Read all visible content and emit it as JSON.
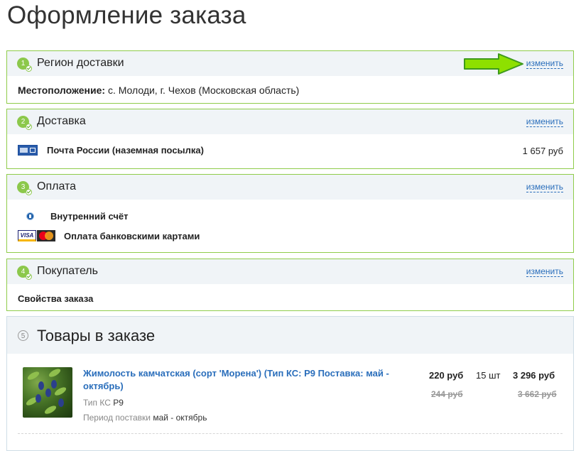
{
  "page": {
    "title": "Оформление заказа"
  },
  "colors": {
    "section_border": "#8fcc4a",
    "header_bg": "#f0f4f7",
    "link": "#2a6ebb",
    "step": "#8cc84b",
    "arrow": "#8ee000"
  },
  "sections": {
    "region": {
      "step": "1",
      "title": "Регион доставки",
      "change_label": "изменить",
      "location_label": "Местоположение:",
      "location_value": "с. Молоди, г. Чехов (Московская область)"
    },
    "delivery": {
      "step": "2",
      "title": "Доставка",
      "change_label": "изменить",
      "method": "Почта России (наземная посылка)",
      "price": "1 657 руб"
    },
    "payment": {
      "step": "3",
      "title": "Оплата",
      "change_label": "изменить",
      "internal_account": "Внутренний счёт",
      "bank_cards": "Оплата банковскими картами",
      "visa_label": "VISA"
    },
    "buyer": {
      "step": "4",
      "title": "Покупатель",
      "change_label": "изменить",
      "order_props": "Свойства заказа"
    }
  },
  "goods": {
    "step": "5",
    "title": "Товары в заказе",
    "items": [
      {
        "name": "Жимолость камчатская (сорт 'Морена') (Тип КС: Р9 Поставка: май - октябрь)",
        "prop1_label": "Тип КС",
        "prop1_value": "Р9",
        "prop2_label": "Период поставки",
        "prop2_value": "май - октябрь",
        "price": "220 руб",
        "old_price": "244 руб",
        "qty": "15 шт",
        "sum": "3 296 руб",
        "old_sum": "3 662 руб"
      }
    ]
  }
}
